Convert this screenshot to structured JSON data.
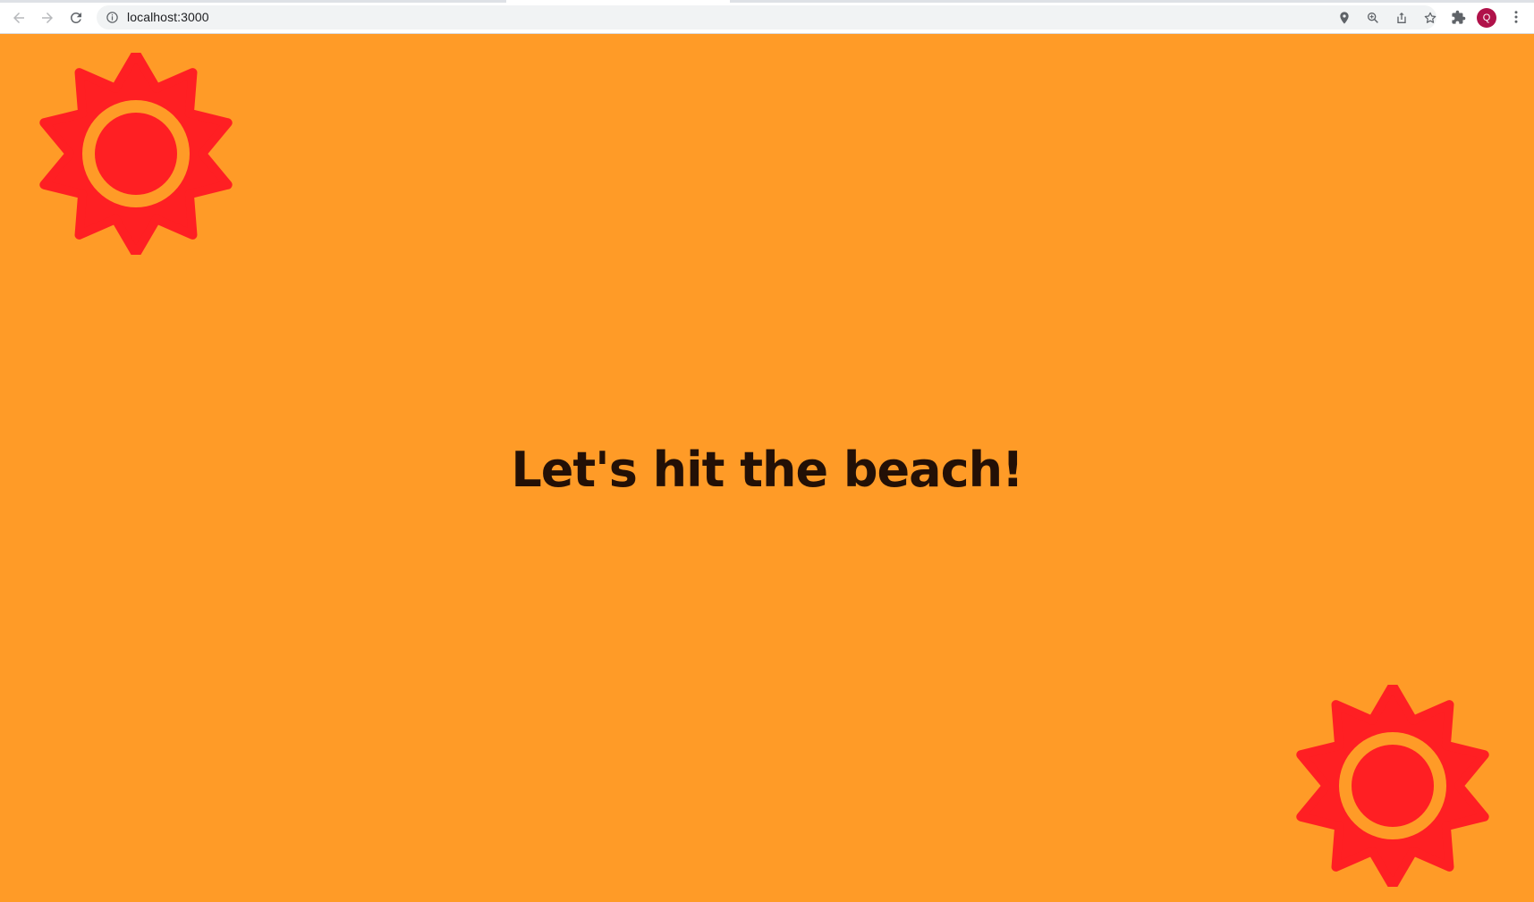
{
  "browser": {
    "url": "localhost:3000",
    "avatar_initial": "Q",
    "avatar_color": "#b0124a",
    "icons": {
      "back": "back-arrow-icon",
      "forward": "forward-arrow-icon",
      "reload": "reload-icon",
      "site_info": "info-icon",
      "location": "location-pin-icon",
      "zoom": "zoom-icon",
      "share": "share-icon",
      "bookmark": "star-icon",
      "extensions": "puzzle-icon",
      "menu": "kebab-menu-icon"
    }
  },
  "page": {
    "headline": "Let's hit the beach!",
    "background_color": "#ff9b27",
    "sun_color": "#ff1f23",
    "text_color": "#231006",
    "decorations": [
      "sun-icon",
      "sun-icon"
    ]
  }
}
